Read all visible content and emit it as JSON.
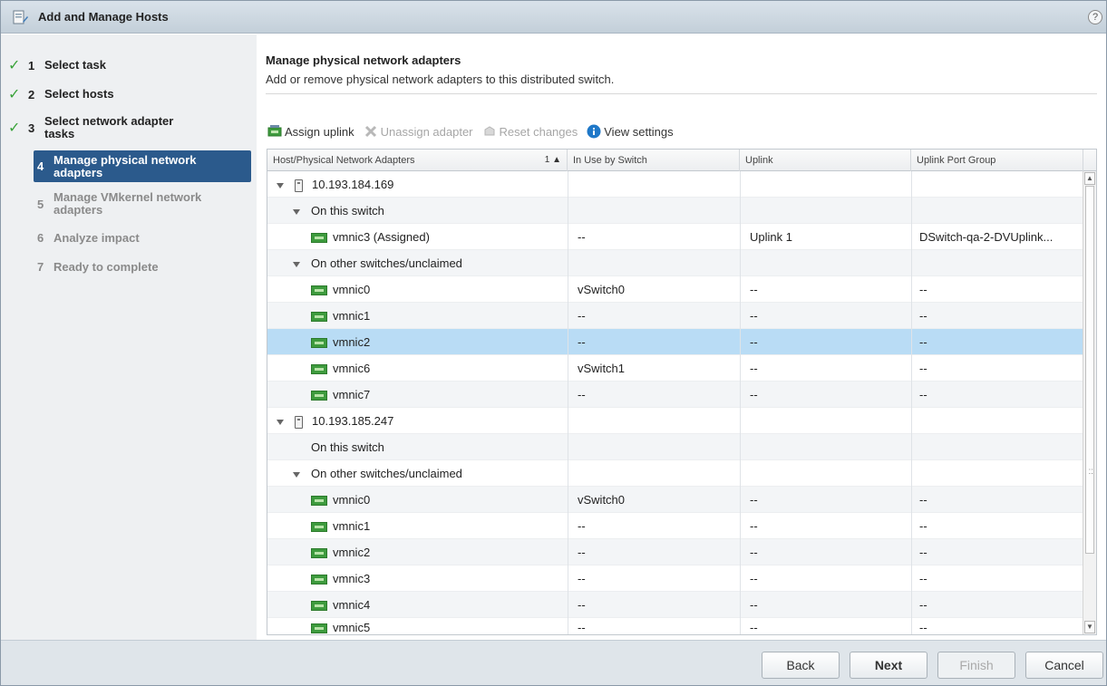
{
  "window": {
    "title": "Add and Manage Hosts",
    "help": "?"
  },
  "steps": [
    {
      "num": "1",
      "label": "Select task",
      "state": "done"
    },
    {
      "num": "2",
      "label": "Select hosts",
      "state": "done"
    },
    {
      "num": "3",
      "label": "Select network adapter tasks",
      "state": "done"
    },
    {
      "num": "4",
      "label": "Manage physical network adapters",
      "state": "active"
    },
    {
      "num": "5",
      "label": "Manage VMkernel network adapters",
      "state": "future"
    },
    {
      "num": "6",
      "label": "Analyze impact",
      "state": "future"
    },
    {
      "num": "7",
      "label": "Ready to complete",
      "state": "future"
    }
  ],
  "page": {
    "title": "Manage physical network adapters",
    "subtitle": "Add or remove physical network adapters to this distributed switch."
  },
  "toolbar": {
    "assign": "Assign uplink",
    "unassign": "Unassign adapter",
    "reset": "Reset changes",
    "view": "View settings"
  },
  "grid": {
    "columns": [
      "Host/Physical Network Adapters",
      "In Use by Switch",
      "Uplink",
      "Uplink Port Group"
    ],
    "sort_mark": "1 ▲",
    "rows": [
      {
        "type": "host",
        "name": "10.193.184.169",
        "switch": "",
        "uplink": "",
        "group": ""
      },
      {
        "type": "group",
        "name": "On this switch",
        "switch": "",
        "uplink": "",
        "group": "",
        "expand": true
      },
      {
        "type": "nic",
        "name": "vmnic3 (Assigned)",
        "switch": "--",
        "uplink": "Uplink 1",
        "group": "DSwitch-qa-2-DVUplink..."
      },
      {
        "type": "group",
        "name": "On other switches/unclaimed",
        "switch": "",
        "uplink": "",
        "group": "",
        "expand": true
      },
      {
        "type": "nic",
        "name": "vmnic0",
        "switch": "vSwitch0",
        "uplink": "--",
        "group": "--"
      },
      {
        "type": "nic",
        "name": "vmnic1",
        "switch": "--",
        "uplink": "--",
        "group": "--"
      },
      {
        "type": "nic",
        "name": "vmnic2",
        "switch": "--",
        "uplink": "--",
        "group": "--",
        "selected": true
      },
      {
        "type": "nic",
        "name": "vmnic6",
        "switch": "vSwitch1",
        "uplink": "--",
        "group": "--"
      },
      {
        "type": "nic",
        "name": "vmnic7",
        "switch": "--",
        "uplink": "--",
        "group": "--"
      },
      {
        "type": "host",
        "name": "10.193.185.247",
        "switch": "",
        "uplink": "",
        "group": ""
      },
      {
        "type": "group",
        "name": "On this switch",
        "switch": "",
        "uplink": "",
        "group": "",
        "expand": false
      },
      {
        "type": "group",
        "name": "On other switches/unclaimed",
        "switch": "",
        "uplink": "",
        "group": "",
        "expand": true
      },
      {
        "type": "nic",
        "name": "vmnic0",
        "switch": "vSwitch0",
        "uplink": "--",
        "group": "--"
      },
      {
        "type": "nic",
        "name": "vmnic1",
        "switch": "--",
        "uplink": "--",
        "group": "--"
      },
      {
        "type": "nic",
        "name": "vmnic2",
        "switch": "--",
        "uplink": "--",
        "group": "--"
      },
      {
        "type": "nic",
        "name": "vmnic3",
        "switch": "--",
        "uplink": "--",
        "group": "--"
      },
      {
        "type": "nic",
        "name": "vmnic4",
        "switch": "--",
        "uplink": "--",
        "group": "--"
      },
      {
        "type": "nic",
        "name": "vmnic5",
        "switch": "--",
        "uplink": "--",
        "group": "--"
      }
    ]
  },
  "footer": {
    "back": "Back",
    "next": "Next",
    "finish": "Finish",
    "cancel": "Cancel"
  }
}
